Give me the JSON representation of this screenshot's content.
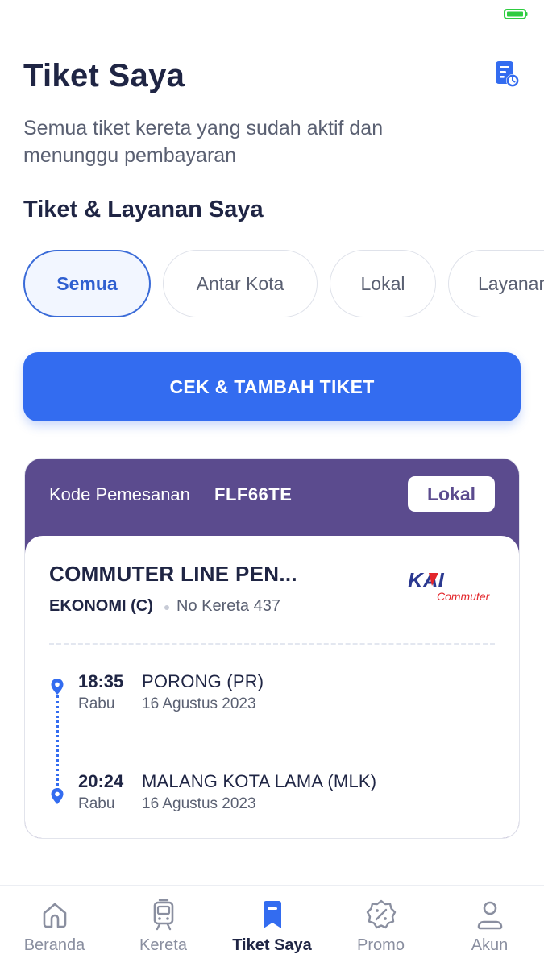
{
  "header": {
    "title": "Tiket Saya",
    "subtitle": "Semua tiket kereta yang sudah aktif dan menunggu pembayaran"
  },
  "section": {
    "title": "Tiket & Layanan Saya"
  },
  "filters": [
    {
      "label": "Semua",
      "active": true
    },
    {
      "label": "Antar Kota",
      "active": false
    },
    {
      "label": "Lokal",
      "active": false
    },
    {
      "label": "Layanan",
      "active": false
    }
  ],
  "primary_button": {
    "label": "CEK & TAMBAH TIKET"
  },
  "ticket": {
    "booking_label": "Kode Pemesanan",
    "booking_code": "FLF66TE",
    "type_badge": "Lokal",
    "train_name": "COMMUTER LINE PEN...",
    "train_class": "EKONOMI (C)",
    "train_number": "No Kereta 437",
    "logo": {
      "brand": "KAI",
      "sub": "Commuter"
    },
    "departure": {
      "time": "18:35",
      "day": "Rabu",
      "station": "PORONG (PR)",
      "date": "16 Agustus 2023"
    },
    "arrival": {
      "time": "20:24",
      "day": "Rabu",
      "station": "MALANG KOTA LAMA (MLK)",
      "date": "16 Agustus 2023"
    }
  },
  "bottom_nav": [
    {
      "label": "Beranda",
      "icon": "home-icon",
      "active": false
    },
    {
      "label": "Kereta",
      "icon": "train-icon",
      "active": false
    },
    {
      "label": "Tiket Saya",
      "icon": "ticket-bookmark-icon",
      "active": true
    },
    {
      "label": "Promo",
      "icon": "promo-badge-icon",
      "active": false
    },
    {
      "label": "Akun",
      "icon": "user-icon",
      "active": false
    }
  ],
  "colors": {
    "primary": "#336cf0",
    "ticket_header": "#5b4b8e",
    "text_dark": "#1f2544",
    "text_muted": "#5a6072",
    "battery": "#2ecc40",
    "kai_red": "#e3262b",
    "kai_navy": "#2b3990"
  }
}
